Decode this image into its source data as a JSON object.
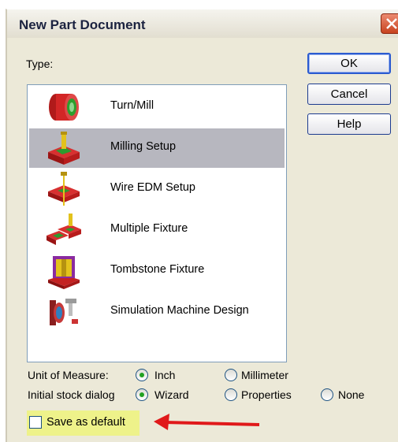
{
  "dialog": {
    "title": "New Part Document",
    "type_label": "Type:"
  },
  "buttons": {
    "ok": "OK",
    "cancel": "Cancel",
    "help": "Help"
  },
  "types": [
    {
      "label": "Turn/Mill",
      "icon": "turn-mill-icon",
      "selected": false
    },
    {
      "label": "Milling Setup",
      "icon": "milling-setup-icon",
      "selected": true
    },
    {
      "label": "Wire EDM Setup",
      "icon": "wire-edm-icon",
      "selected": false
    },
    {
      "label": "Multiple Fixture",
      "icon": "multiple-fixture-icon",
      "selected": false
    },
    {
      "label": "Tombstone Fixture",
      "icon": "tombstone-fixture-icon",
      "selected": false
    },
    {
      "label": "Simulation Machine Design",
      "icon": "simulation-machine-icon",
      "selected": false
    }
  ],
  "unit_of_measure": {
    "label": "Unit of Measure:",
    "options": [
      "Inch",
      "Millimeter"
    ],
    "selected": "Inch"
  },
  "stock_dialog": {
    "label": "Initial stock dialog",
    "options": [
      "Wizard",
      "Properties",
      "None"
    ],
    "selected": "Wizard"
  },
  "save_default": {
    "label": "Save as default",
    "checked": false
  },
  "colors": {
    "highlight": "#eef28a",
    "arrow": "#e0191a",
    "selection": "#b7b7bf"
  }
}
